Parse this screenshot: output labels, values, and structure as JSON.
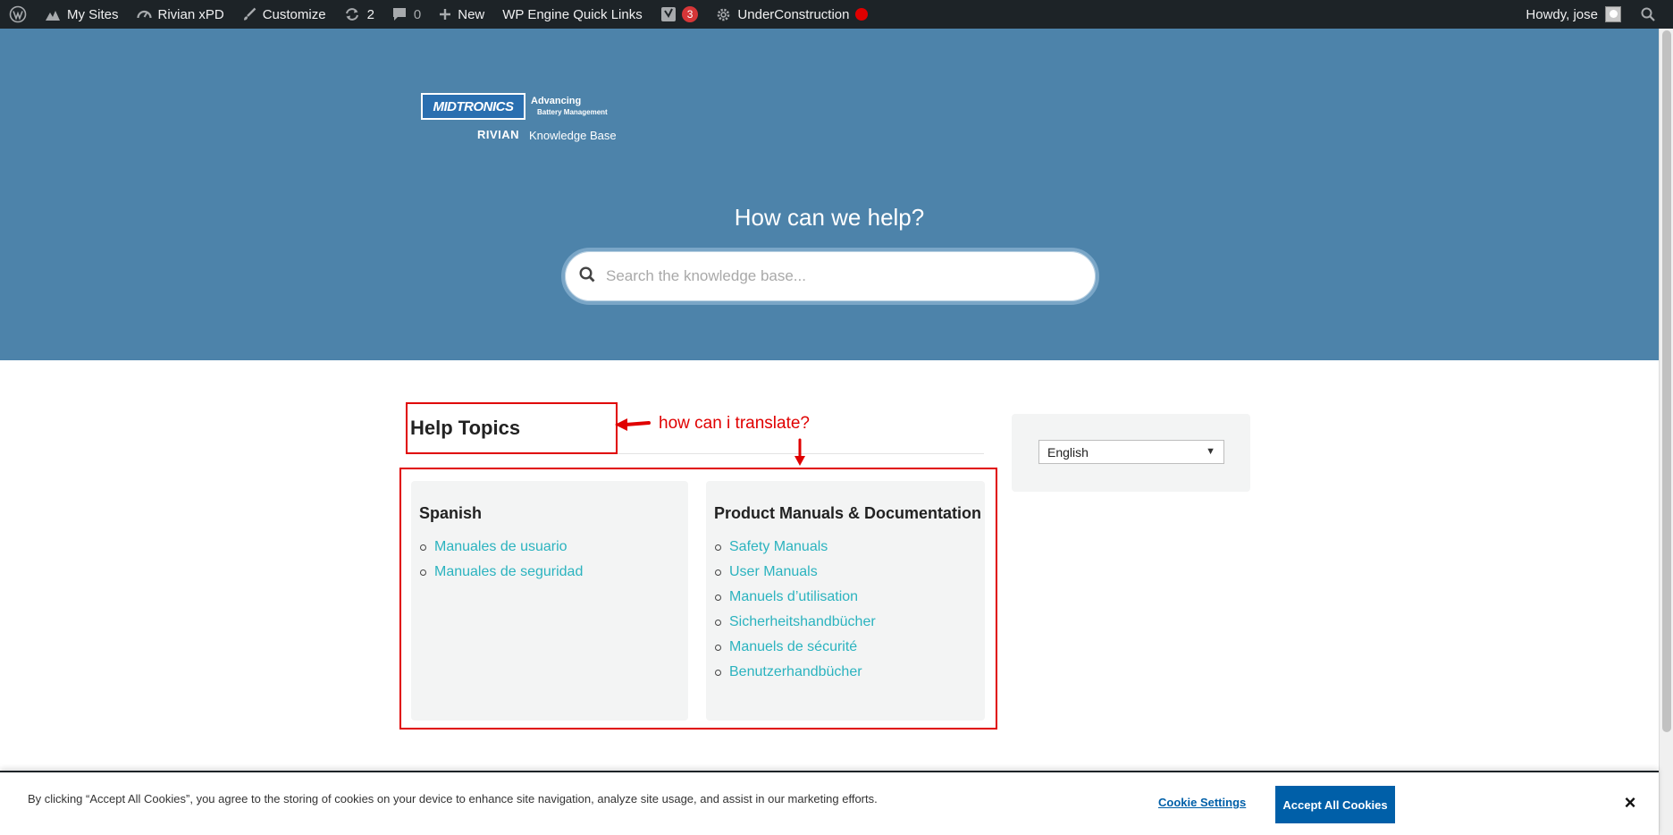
{
  "admin_bar": {
    "my_sites": "My Sites",
    "site_name": "Rivian xPD",
    "customize": "Customize",
    "updates_count": "2",
    "comments_count": "0",
    "new": "New",
    "quick_links": "WP Engine Quick Links",
    "yoast_badge": "3",
    "under_construction": "UnderConstruction",
    "howdy": "Howdy, jose",
    "icons": [
      "wordpress-icon",
      "my-sites-icon",
      "dashboard-icon",
      "brush-icon",
      "updates-icon",
      "comment-icon",
      "plus-icon",
      "yoast-icon",
      "gear-icon",
      "search-icon"
    ]
  },
  "logo": {
    "brand": "MIDTRONICS",
    "tagline_1": "Advancing",
    "tagline_2": "Battery Management",
    "partner": "RIVIAN",
    "section": "Knowledge Base"
  },
  "hero": {
    "title": "How can we help?",
    "search_placeholder": "Search the knowledge base..."
  },
  "help": {
    "heading": "Help Topics",
    "annotation": "how can i translate?",
    "cards": [
      {
        "title": "Spanish",
        "links": [
          "Manuales de usuario",
          "Manuales de seguridad"
        ]
      },
      {
        "title": "Product Manuals & Documentation",
        "links": [
          "Safety Manuals",
          "User Manuals",
          "Manuels d’utilisation",
          "Sicherheitshandbücher",
          "Manuels de sécurité",
          "Benutzerhandbücher"
        ]
      }
    ]
  },
  "sidebar": {
    "language_selected": "English"
  },
  "cookie": {
    "text": "By clicking “Accept All Cookies”, you agree to the storing of cookies on your device to enhance site navigation, analyze site usage, and assist in our marketing efforts.",
    "settings": "Cookie Settings",
    "accept": "Accept All Cookies",
    "close": "×"
  },
  "colors": {
    "admin_bar": "#1d2327",
    "hero": "#4d83aa",
    "link": "#2bb3bf",
    "annotation": "#e00000",
    "cookie_button": "#005fa8"
  }
}
